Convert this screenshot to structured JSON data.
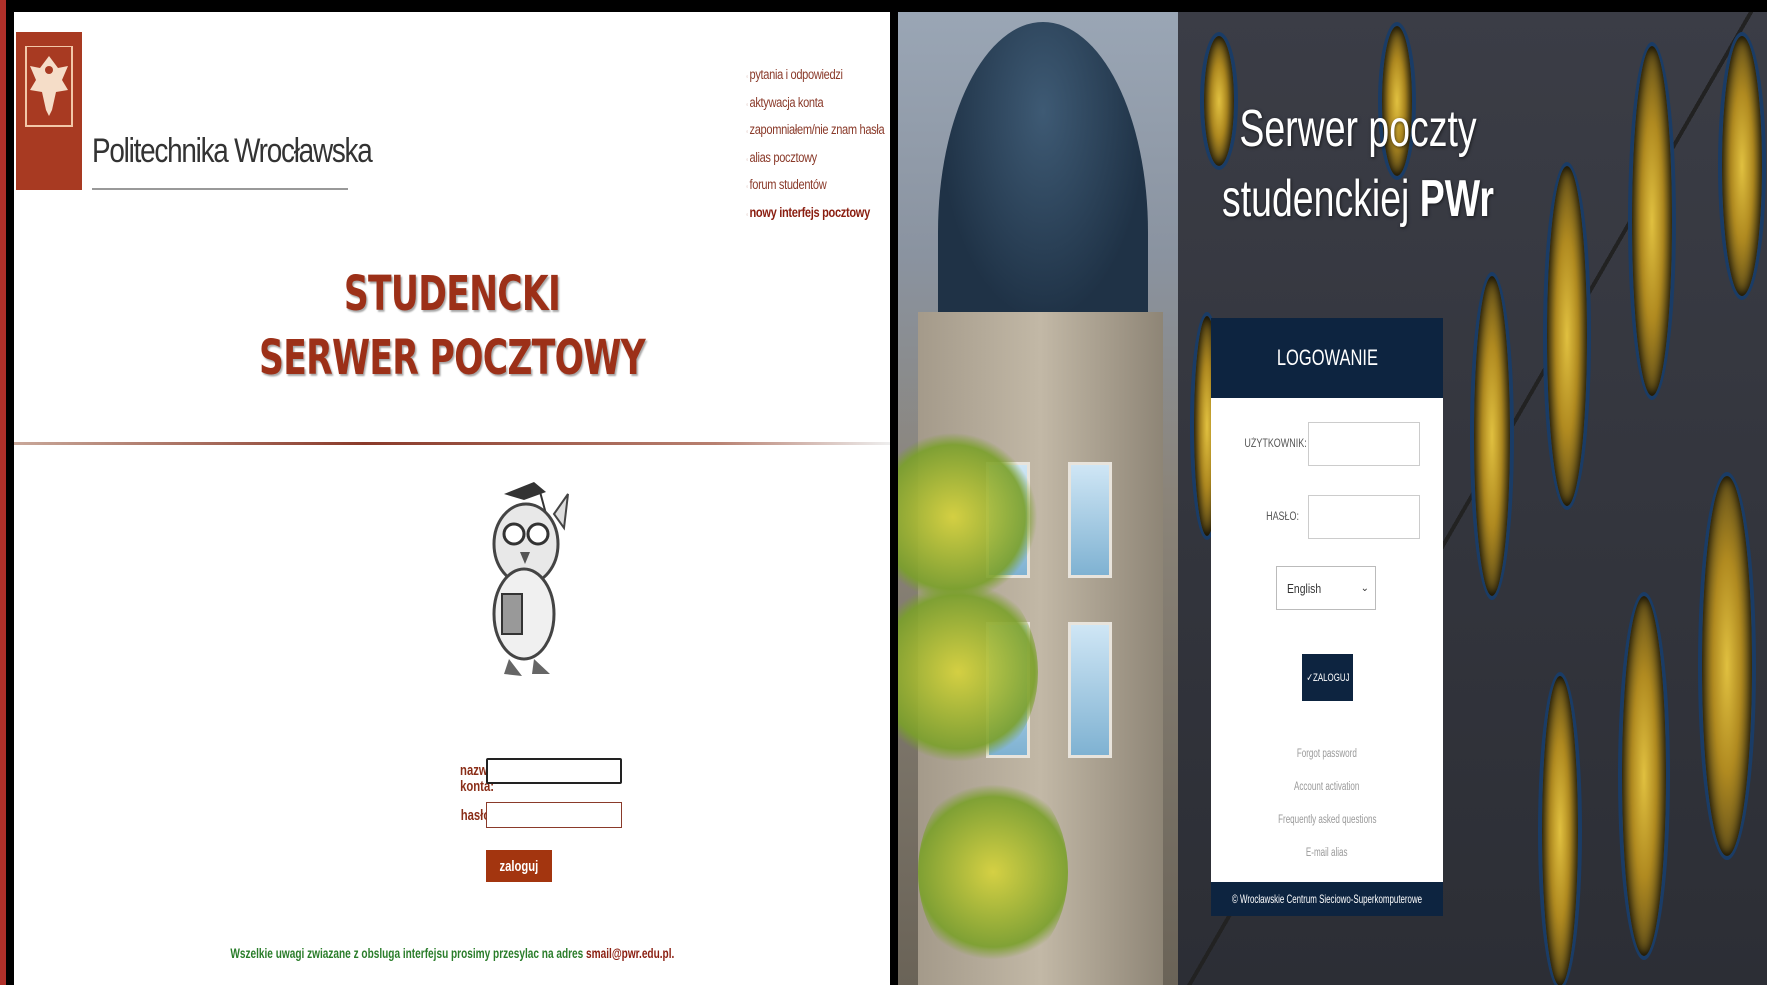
{
  "left": {
    "university_name": "Politechnika Wrocławska",
    "links": [
      {
        "label": "pytania i odpowiedzi",
        "active": false
      },
      {
        "label": "aktywacja konta",
        "active": false
      },
      {
        "label": "zapomniałem/nie znam hasła",
        "active": false
      },
      {
        "label": "alias pocztowy",
        "active": false
      },
      {
        "label": "forum studentów",
        "active": false
      },
      {
        "label": "nowy interfejs pocztowy",
        "active": true
      }
    ],
    "title_line1": "STUDENCKI",
    "title_line2": "SERWER  POCZTOWY",
    "form": {
      "username_label": "nazwa konta:",
      "password_label": "hasło:",
      "username_value": "",
      "password_value": "",
      "submit_label": "zaloguj"
    },
    "footer_note": "Wszelkie uwagi zwiazane z obsluga interfejsu prosimy przesylac na adres ",
    "footer_email": "smail@pwr.edu.pl."
  },
  "right": {
    "title_line1": "Serwer poczty",
    "title_line2_prefix": "studenckiej ",
    "title_line2_bold": "PWr",
    "card": {
      "heading": "LOGOWANIE",
      "username_label": "UŻYTKOWNIK:",
      "password_label": "HASŁO:",
      "username_value": "",
      "password_value": "",
      "language_selected": "English",
      "submit_label": "✓ZALOGUJ",
      "links": [
        "Forgot password",
        "Account activation",
        "Frequently asked questions",
        "E-mail alias"
      ],
      "footer": "© Wrocławskie Centrum Sieciowo-Superkomputerowe"
    }
  },
  "colors": {
    "pwr_red": "#a83a22",
    "link_brown": "#8a3a2a",
    "footer_green": "#2a7d2a",
    "navy": "#0d2440"
  }
}
